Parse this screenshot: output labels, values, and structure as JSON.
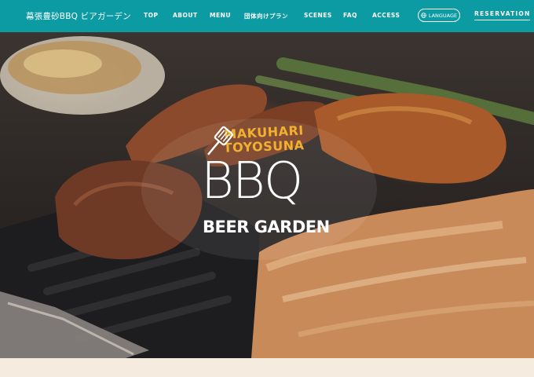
{
  "header": {
    "site_title": "幕張豊砂BBQ ビアガーデン",
    "nav": [
      {
        "label": "TOP"
      },
      {
        "label": "ABOUT"
      },
      {
        "label": "MENU"
      },
      {
        "label": "団体向けプラン"
      },
      {
        "label": "SCENES"
      },
      {
        "label": "FAQ"
      },
      {
        "label": "ACCESS"
      }
    ],
    "language_button": "LANGUAGE",
    "reservation_button": "RESERVATION"
  },
  "hero": {
    "logo_line1": "MAKUHARI",
    "logo_line2": "TOYOSUNA",
    "logo_main": "BBQ",
    "logo_sub": "BEER GARDEN"
  },
  "colors": {
    "header_bg": "#0c9aa3",
    "logo_accent": "#f1b12f",
    "page_bg": "#f5ecdf"
  },
  "icons": {
    "language": "globe-icon",
    "logo_utensil": "spatula-icon"
  }
}
